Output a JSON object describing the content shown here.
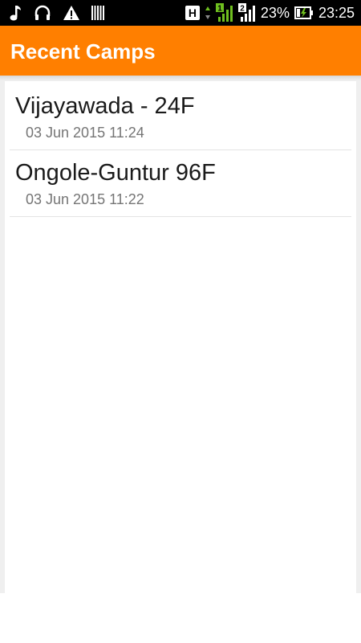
{
  "status_bar": {
    "left_icons": [
      "music-note-icon",
      "headset-icon",
      "warning-icon",
      "barcode-icon"
    ],
    "network_type": "H",
    "sim1_label": "1",
    "sim2_label": "2",
    "battery_percent": "23%",
    "time": "23:25",
    "colors": {
      "background": "#000000",
      "signal_active": "#6fbf1f"
    }
  },
  "app_bar": {
    "title": "Recent Camps",
    "color": "#ff7f00"
  },
  "camps": [
    {
      "name": "Vijayawada - 24F",
      "datetime": "03 Jun 2015 11:24"
    },
    {
      "name": "Ongole-Guntur 96F",
      "datetime": "03 Jun 2015 11:22"
    }
  ]
}
